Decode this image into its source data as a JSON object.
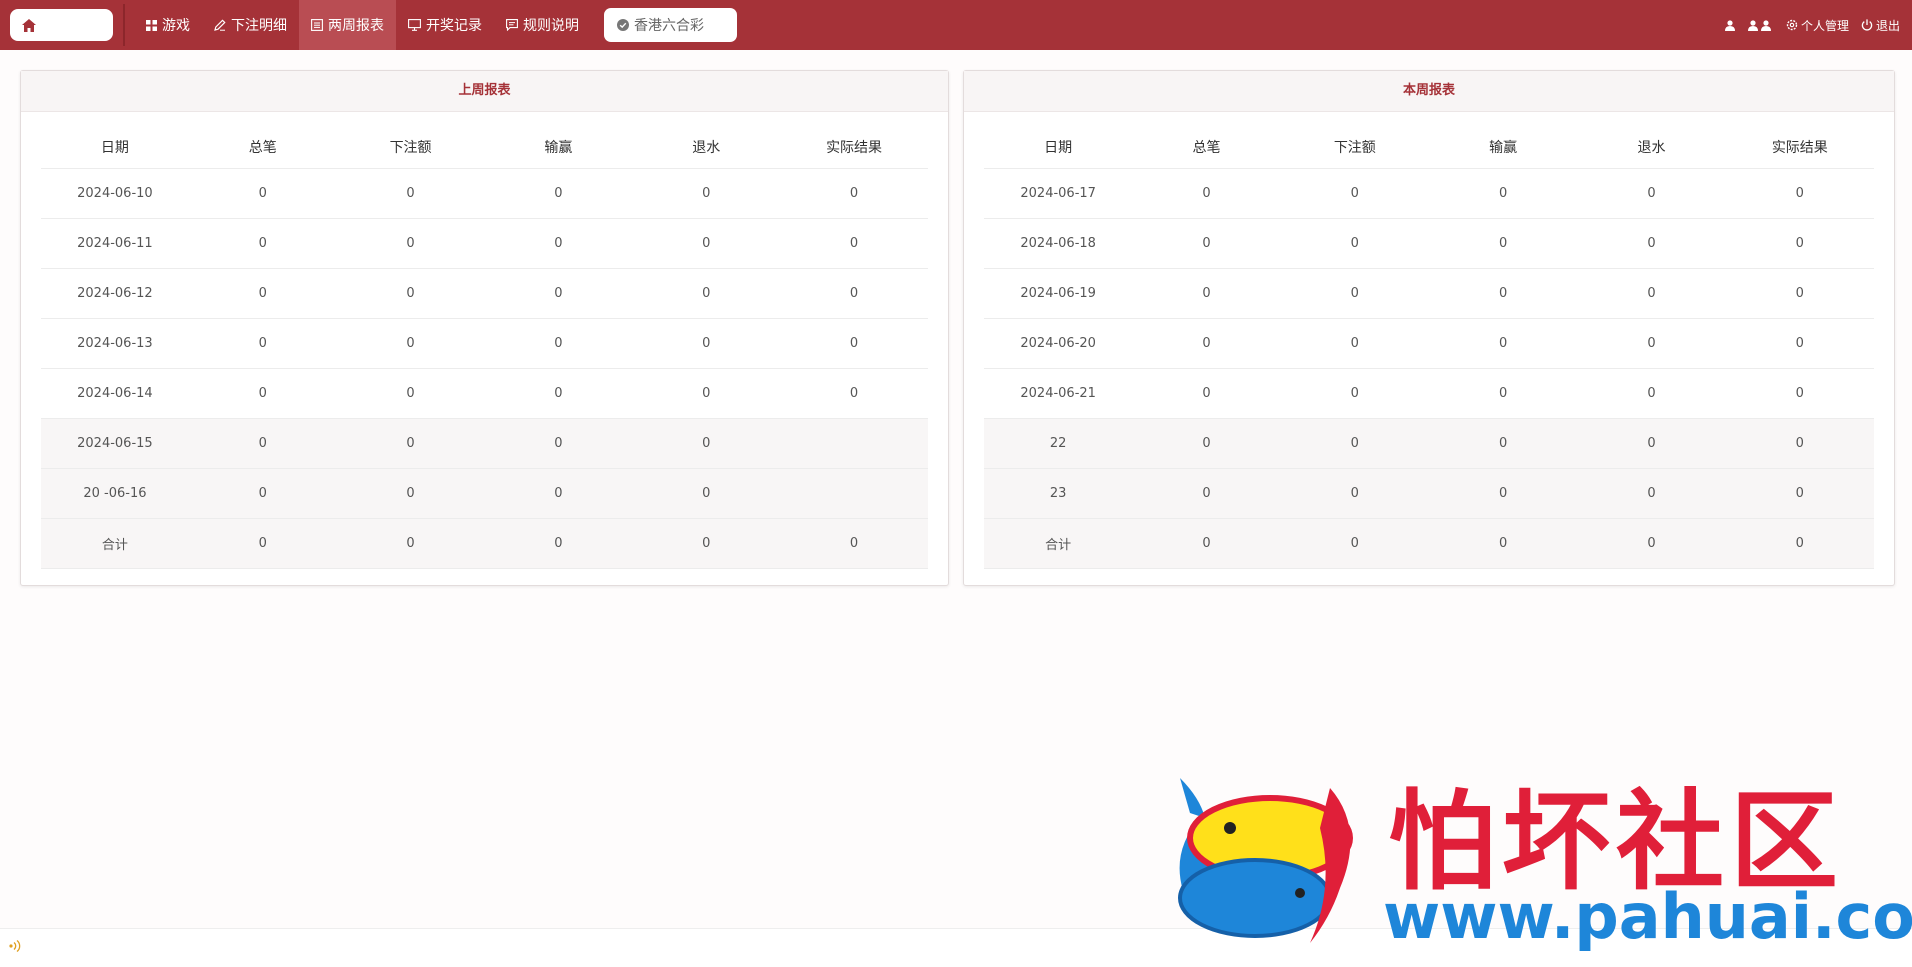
{
  "nav": {
    "items": [
      {
        "label": "游戏",
        "icon": "grid-icon"
      },
      {
        "label": "下注明细",
        "icon": "pencil-icon"
      },
      {
        "label": "两周报表",
        "icon": "list-icon"
      },
      {
        "label": "开奖记录",
        "icon": "monitor-icon"
      },
      {
        "label": "规则说明",
        "icon": "message-icon"
      }
    ],
    "active_index": 2,
    "lottery_label": "香港六合彩",
    "right": {
      "profile_label": "个人管理",
      "logout_label": "退出"
    }
  },
  "last_week": {
    "title": "上周报表",
    "headers": [
      "日期",
      "总笔",
      "下注额",
      "输赢",
      "退水",
      "实际结果"
    ],
    "rows": [
      [
        "2024-06-10",
        "0",
        "0",
        "0",
        "0",
        "0"
      ],
      [
        "2024-06-11",
        "0",
        "0",
        "0",
        "0",
        "0"
      ],
      [
        "2024-06-12",
        "0",
        "0",
        "0",
        "0",
        "0"
      ],
      [
        "2024-06-13",
        "0",
        "0",
        "0",
        "0",
        "0"
      ],
      [
        "2024-06-14",
        "0",
        "0",
        "0",
        "0",
        "0"
      ],
      [
        "2024-06-15",
        "0",
        "0",
        "0",
        "0",
        ""
      ],
      [
        "20   -06-16",
        "0",
        "0",
        "0",
        "0",
        ""
      ],
      [
        "合计",
        "0",
        "0",
        "0",
        "0",
        "0"
      ]
    ]
  },
  "this_week": {
    "title": "本周报表",
    "headers": [
      "日期",
      "总笔",
      "下注额",
      "输赢",
      "退水",
      "实际结果"
    ],
    "rows": [
      [
        "2024-06-17",
        "0",
        "0",
        "0",
        "0",
        "0"
      ],
      [
        "2024-06-18",
        "0",
        "0",
        "0",
        "0",
        "0"
      ],
      [
        "2024-06-19",
        "0",
        "0",
        "0",
        "0",
        "0"
      ],
      [
        "2024-06-20",
        "0",
        "0",
        "0",
        "0",
        "0"
      ],
      [
        "2024-06-21",
        "0",
        "0",
        "0",
        "0",
        "0"
      ],
      [
        "22",
        "0",
        "0",
        "0",
        "0",
        "0"
      ],
      [
        "23",
        "0",
        "0",
        "0",
        "0",
        "0"
      ],
      [
        "合计",
        "0",
        "0",
        "0",
        "0",
        "0"
      ]
    ]
  },
  "watermark": {
    "title": "怕坏社区",
    "url": "www.pahuai.com"
  },
  "colors": {
    "topbar": "#a53238",
    "active_tab": "#b94d53",
    "panel_title": "#a53238",
    "watermark_red": "#e01f39",
    "watermark_blue": "#1e86d9"
  }
}
